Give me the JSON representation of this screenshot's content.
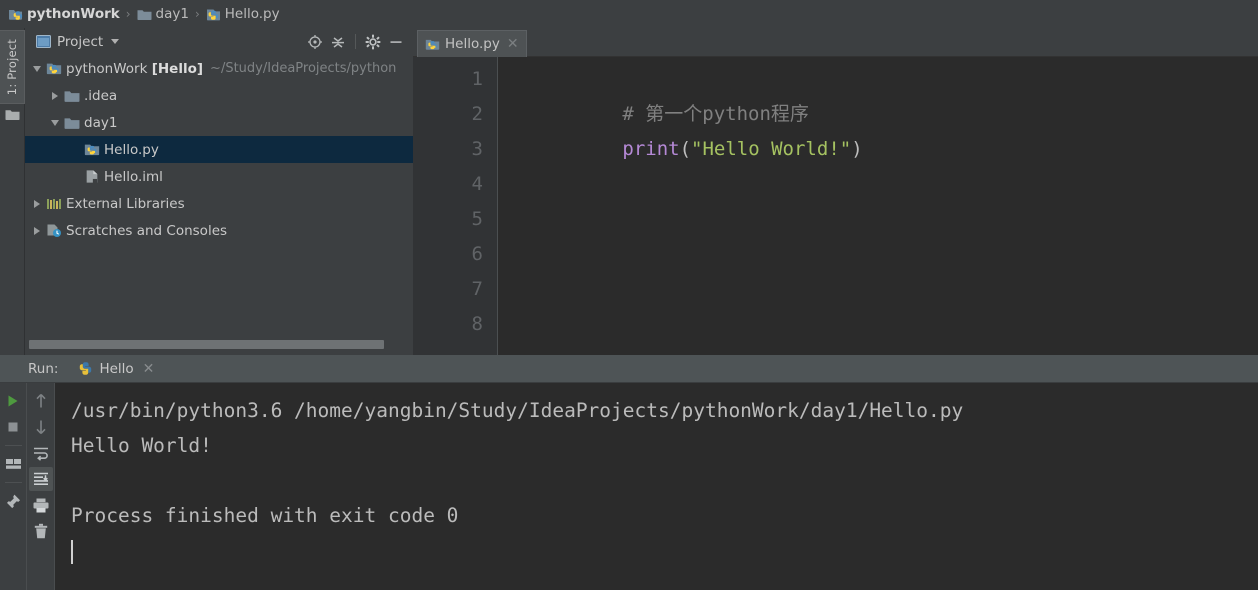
{
  "breadcrumb": {
    "items": [
      {
        "label": "pythonWork",
        "icon": "python-project-icon",
        "bold": true
      },
      {
        "label": "day1",
        "icon": "folder-icon",
        "bold": false
      },
      {
        "label": "Hello.py",
        "icon": "python-file-icon",
        "bold": false
      }
    ],
    "separator": "›"
  },
  "tool_strip": {
    "project_tab_label": "1: Project",
    "project_tab_icon": "project-window-icon",
    "folder_icon": "folder-icon"
  },
  "project_panel": {
    "title": "Project",
    "title_icon": "project-window-icon",
    "caret_icon": "chevron-down-icon",
    "toolbar": [
      {
        "name": "scroll-from-source-icon",
        "tooltip": "Select Opened File"
      },
      {
        "name": "collapse-all-icon",
        "tooltip": "Collapse All"
      },
      {
        "name": "gear-icon",
        "tooltip": "Settings"
      },
      {
        "name": "minimize-icon",
        "tooltip": "Hide"
      }
    ],
    "tree": [
      {
        "label": "pythonWork",
        "bold_suffix": "[Hello]",
        "path": "~/Study/IdeaProjects/python",
        "icon": "python-project-icon",
        "expanded": true,
        "indent": 0,
        "selected": false
      },
      {
        "label": ".idea",
        "icon": "folder-icon",
        "expanded": false,
        "indent": 1,
        "selected": false
      },
      {
        "label": "day1",
        "icon": "folder-icon",
        "expanded": true,
        "indent": 1,
        "selected": false
      },
      {
        "label": "Hello.py",
        "icon": "python-file-icon",
        "expanded": null,
        "indent": 2,
        "selected": true
      },
      {
        "label": "Hello.iml",
        "icon": "iml-file-icon",
        "expanded": null,
        "indent": 1,
        "selected": false
      },
      {
        "label": "External Libraries",
        "icon": "libraries-icon",
        "expanded": false,
        "indent": 0,
        "selected": false
      },
      {
        "label": "Scratches and Consoles",
        "icon": "scratches-icon",
        "expanded": false,
        "indent": 0,
        "selected": false
      }
    ]
  },
  "editor": {
    "tab": {
      "label": "Hello.py",
      "icon": "python-file-icon",
      "close_icon": "close-icon"
    },
    "line_numbers": [
      "1",
      "2",
      "3",
      "4",
      "5",
      "6",
      "7",
      "8"
    ],
    "lines": [
      {
        "n": "1",
        "tokens": [
          {
            "t": "# 第一个python程序",
            "c": "comment"
          }
        ]
      },
      {
        "n": "2",
        "tokens": [
          {
            "t": "print",
            "c": "func"
          },
          {
            "t": "(",
            "c": "punct"
          },
          {
            "t": "\"Hello World!\"",
            "c": "string"
          },
          {
            "t": ")",
            "c": "punct"
          }
        ]
      },
      {
        "n": "3",
        "tokens": []
      },
      {
        "n": "4",
        "tokens": []
      },
      {
        "n": "5",
        "tokens": []
      },
      {
        "n": "6",
        "tokens": []
      },
      {
        "n": "7",
        "tokens": []
      },
      {
        "n": "8",
        "tokens": []
      }
    ]
  },
  "run_panel": {
    "label": "Run:",
    "tab": {
      "label": "Hello",
      "icon": "python-icon",
      "close_icon": "close-icon"
    },
    "toolbar_left": [
      {
        "name": "run-icon",
        "tooltip": "Rerun"
      },
      {
        "name": "stop-icon",
        "tooltip": "Stop"
      },
      {
        "name": "restore-layout-icon",
        "tooltip": "Restore Layout"
      },
      {
        "name": "pin-icon",
        "tooltip": "Pin Tab"
      }
    ],
    "toolbar_right": [
      {
        "name": "arrow-up-icon",
        "tooltip": "Up the Stack Trace"
      },
      {
        "name": "arrow-down-icon",
        "tooltip": "Down the Stack Trace"
      },
      {
        "name": "soft-wrap-icon",
        "tooltip": "Use Soft Wraps"
      },
      {
        "name": "scroll-to-end-icon",
        "tooltip": "Scroll to the end",
        "active": true
      },
      {
        "name": "print-icon",
        "tooltip": "Print"
      },
      {
        "name": "trash-icon",
        "tooltip": "Clear All"
      }
    ],
    "console_lines": [
      "/usr/bin/python3.6 /home/yangbin/Study/IdeaProjects/pythonWork/day1/Hello.py",
      "Hello World!",
      "",
      "Process finished with exit code 0"
    ]
  },
  "colors": {
    "window_bg": "#3c3f41",
    "editor_bg": "#2b2b2b",
    "selection_blue": "#0d293f",
    "comment": "#808080",
    "keyword_func": "#b589d6",
    "string": "#a5c261",
    "run_green": "#4e9a3f"
  }
}
